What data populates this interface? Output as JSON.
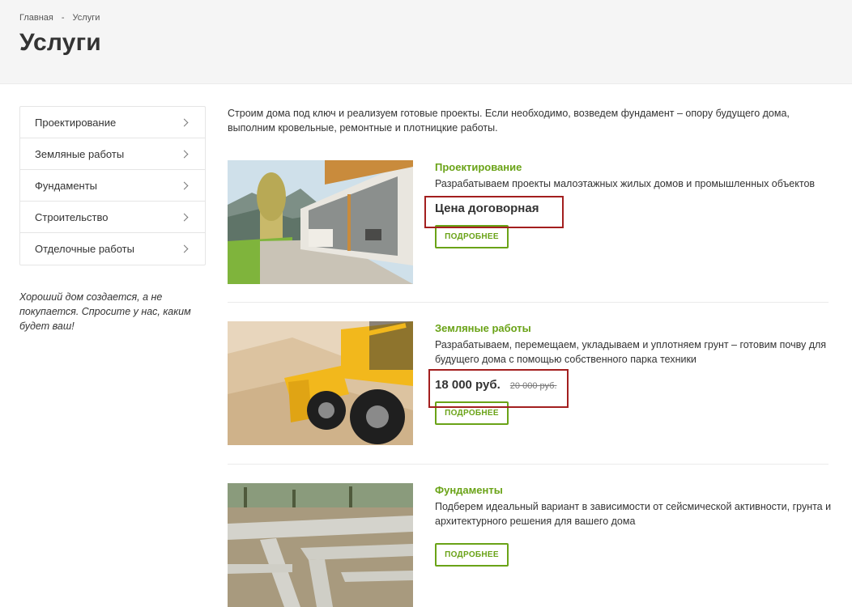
{
  "breadcrumb": {
    "home": "Главная",
    "separator": "-",
    "current": "Услуги"
  },
  "page": {
    "title": "Услуги"
  },
  "sidebar": {
    "items": [
      {
        "label": "Проектирование"
      },
      {
        "label": "Земляные работы"
      },
      {
        "label": "Фундаменты"
      },
      {
        "label": "Строительство"
      },
      {
        "label": "Отделочные работы"
      }
    ],
    "quote": "Хороший дом создается, а не покупается. Спросите у нас, каким будет ваш!"
  },
  "intro": "Строим дома под ключ и реализуем готовые проекты. Если необходимо, возведем фундамент – опору будущего дома, выполним кровельные, ремонтные и плотницкие работы.",
  "services": [
    {
      "title": "Проектирование",
      "description": "Разрабатываем проекты малоэтажных жилых домов и промышленных объектов",
      "price": "Цена договорная",
      "old_price": "",
      "button": "ПОДРОБНЕЕ"
    },
    {
      "title": "Земляные работы",
      "description": "Разрабатываем, перемещаем, укладываем и уплотняем грунт – готовим почву для будущего дома с помощью собственного парка техники",
      "price": "18 000 руб.",
      "old_price": "20 000 руб.",
      "button": "ПОДРОБНЕЕ"
    },
    {
      "title": "Фундаменты",
      "description": "Подберем идеальный вариант в зависимости от сейсмической активности, грунта и архитектурного решения для вашего дома",
      "price": "",
      "old_price": "",
      "button": "ПОДРОБНЕЕ"
    }
  ],
  "colors": {
    "accent": "#6aa317",
    "highlight": "#a31f1f",
    "header_bg": "#f5f5f5"
  }
}
